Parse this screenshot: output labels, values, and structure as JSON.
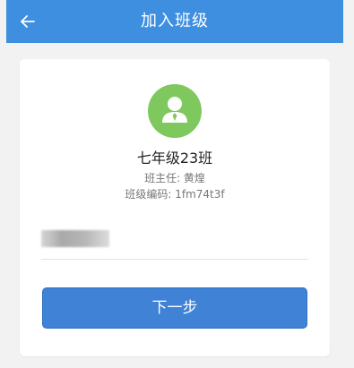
{
  "header": {
    "title": "加入班级",
    "back_icon": "arrow-left-icon",
    "color": "#3f8fe0"
  },
  "class_card": {
    "avatar_icon": "user-tie-icon",
    "avatar_color": "#7ec85e",
    "class_name": "七年级23班",
    "teacher": "班主任: 黄煌",
    "class_code": "班级编码: 1fm74t3f"
  },
  "next_button": {
    "label": "下一步",
    "color": "#3f82d6"
  }
}
